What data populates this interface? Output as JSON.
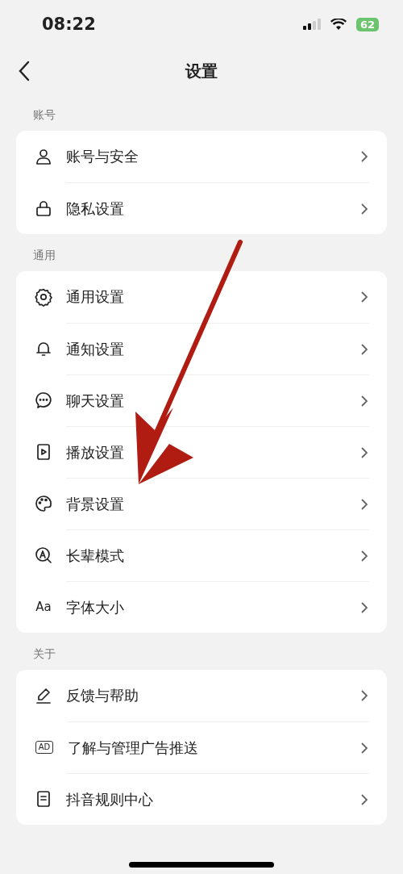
{
  "status_bar": {
    "time": "08:22",
    "battery": "62"
  },
  "nav": {
    "title": "设置"
  },
  "sections": [
    {
      "header": "账号",
      "items": [
        {
          "label": "账号与安全"
        },
        {
          "label": "隐私设置"
        }
      ]
    },
    {
      "header": "通用",
      "items": [
        {
          "label": "通用设置"
        },
        {
          "label": "通知设置"
        },
        {
          "label": "聊天设置"
        },
        {
          "label": "播放设置"
        },
        {
          "label": "背景设置"
        },
        {
          "label": "长辈模式"
        },
        {
          "label": "字体大小",
          "badge": "Aa"
        }
      ]
    },
    {
      "header": "关于",
      "items": [
        {
          "label": "反馈与帮助"
        },
        {
          "label": "了解与管理广告推送",
          "badge": "AD"
        },
        {
          "label": "抖音规则中心"
        }
      ]
    }
  ]
}
